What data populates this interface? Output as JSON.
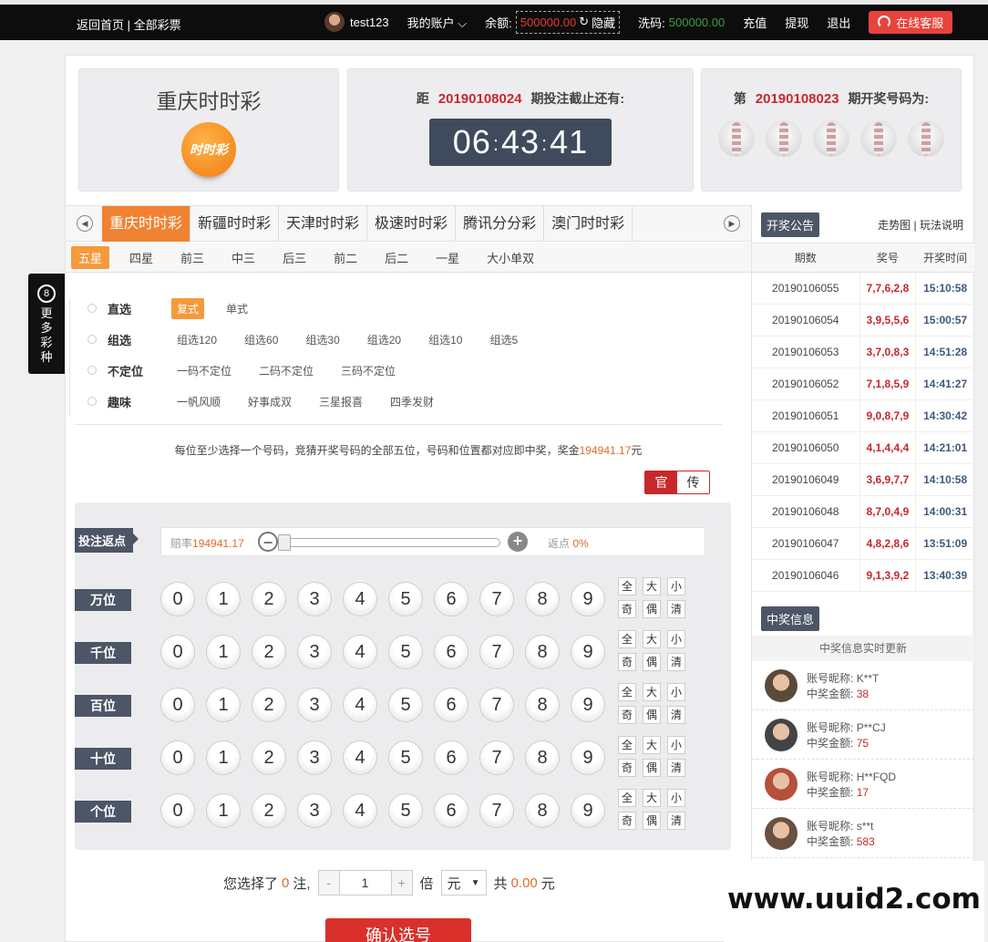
{
  "topbar": {
    "home_link": "返回首页",
    "separator": "|",
    "all_lottery_link": "全部彩票",
    "username": "test123",
    "my_account": "我的账户",
    "balance_label": "余额:",
    "balance_value": "500000.00",
    "hide_label": "隐藏",
    "wash_label": "洗码:",
    "wash_value": "500000.00",
    "recharge": "充值",
    "withdraw": "提现",
    "logout": "退出",
    "customer_service": "在线客服"
  },
  "side_float": {
    "badge": "8",
    "label": "更多彩种"
  },
  "lottery_card": {
    "title": "重庆时时彩",
    "logo_text": "时时彩"
  },
  "countdown": {
    "prefix": "距",
    "issue": "20190108024",
    "suffix": "期投注截止还有:",
    "hours": "06",
    "minutes": "43",
    "seconds": "41",
    "separator": ":"
  },
  "last_draw": {
    "prefix": "第",
    "issue": "20190108023",
    "suffix": "期开奖号码为:",
    "ball_count": 5
  },
  "tabs": [
    "重庆时时彩",
    "新疆时时彩",
    "天津时时彩",
    "极速时时彩",
    "腾讯分分彩",
    "澳门时时彩"
  ],
  "tab_prev": "◀",
  "tab_next": "▶",
  "subtabs": [
    "五星",
    "四星",
    "前三",
    "中三",
    "后三",
    "前二",
    "后二",
    "一星",
    "大小单双"
  ],
  "play_groups": [
    {
      "label": "直选",
      "options": [
        "复式",
        "单式"
      ],
      "active": 0
    },
    {
      "label": "组选",
      "options": [
        "组选120",
        "组选60",
        "组选30",
        "组选20",
        "组选10",
        "组选5"
      ],
      "active": -1
    },
    {
      "label": "不定位",
      "options": [
        "一码不定位",
        "二码不定位",
        "三码不定位"
      ],
      "active": -1
    },
    {
      "label": "趣味",
      "options": [
        "一帆风顺",
        "好事成双",
        "三星报喜",
        "四季发财"
      ],
      "active": -1
    }
  ],
  "description": {
    "text": "每位至少选择一个号码，竞猜开奖号码的全部五位，号码和位置都对应即中奖，奖金",
    "prize": "194941.17",
    "unit": "元"
  },
  "mode_toggle": {
    "official": "官",
    "traditional": "传"
  },
  "rebate": {
    "tag": "投注返点",
    "odds_label": "赔率",
    "odds_value": "194941.17",
    "rebate_label": "返点",
    "rebate_value": "0%",
    "slider_level": 0,
    "minus": "−",
    "plus": "+"
  },
  "positions": [
    "万位",
    "千位",
    "百位",
    "十位",
    "个位"
  ],
  "digits": [
    "0",
    "1",
    "2",
    "3",
    "4",
    "5",
    "6",
    "7",
    "8",
    "9"
  ],
  "quick_buttons": [
    "全",
    "大",
    "小",
    "奇",
    "偶",
    "清"
  ],
  "summary": {
    "selected_prefix": "您选择了",
    "selected_count": "0",
    "selected_suffix": "注,",
    "minus": "-",
    "multiplier": "1",
    "plus": "+",
    "times_label": "倍",
    "unit": "元",
    "caret": "▼",
    "total_label": "共",
    "total_value": "0.00",
    "total_unit": "元"
  },
  "confirm_button": "确认选号",
  "announcement": {
    "badge": "开奖公告",
    "trend_link": "走势图",
    "separator": "|",
    "rules_link": "玩法说明",
    "headers": [
      "期数",
      "奖号",
      "开奖时间"
    ],
    "rows": [
      {
        "issue": "20190106055",
        "numbers": "7,7,6,2,8",
        "time": "15:10:58"
      },
      {
        "issue": "20190106054",
        "numbers": "3,9,5,5,6",
        "time": "15:00:57"
      },
      {
        "issue": "20190106053",
        "numbers": "3,7,0,8,3",
        "time": "14:51:28"
      },
      {
        "issue": "20190106052",
        "numbers": "7,1,8,5,9",
        "time": "14:41:27"
      },
      {
        "issue": "20190106051",
        "numbers": "9,0,8,7,9",
        "time": "14:30:42"
      },
      {
        "issue": "20190106050",
        "numbers": "4,1,4,4,4",
        "time": "14:21:01"
      },
      {
        "issue": "20190106049",
        "numbers": "3,6,9,7,7",
        "time": "14:10:58"
      },
      {
        "issue": "20190106048",
        "numbers": "8,7,0,4,9",
        "time": "14:00:31"
      },
      {
        "issue": "20190106047",
        "numbers": "4,8,2,8,6",
        "time": "13:51:09"
      },
      {
        "issue": "20190106046",
        "numbers": "9,1,3,9,2",
        "time": "13:40:39"
      }
    ]
  },
  "winners": {
    "badge": "中奖信息",
    "subtitle": "中奖信息实时更新",
    "nick_label": "账号昵称:",
    "amount_label": "中奖金额:",
    "items": [
      {
        "nick": "K**T",
        "amount": "38",
        "color": "#5a4a3a"
      },
      {
        "nick": "P**CJ",
        "amount": "75",
        "color": "#444444"
      },
      {
        "nick": "H**FQD",
        "amount": "17",
        "color": "#b5503a"
      },
      {
        "nick": "s**t",
        "amount": "583",
        "color": "#6a5040"
      }
    ]
  },
  "watermark": "www.uuid2.com"
}
